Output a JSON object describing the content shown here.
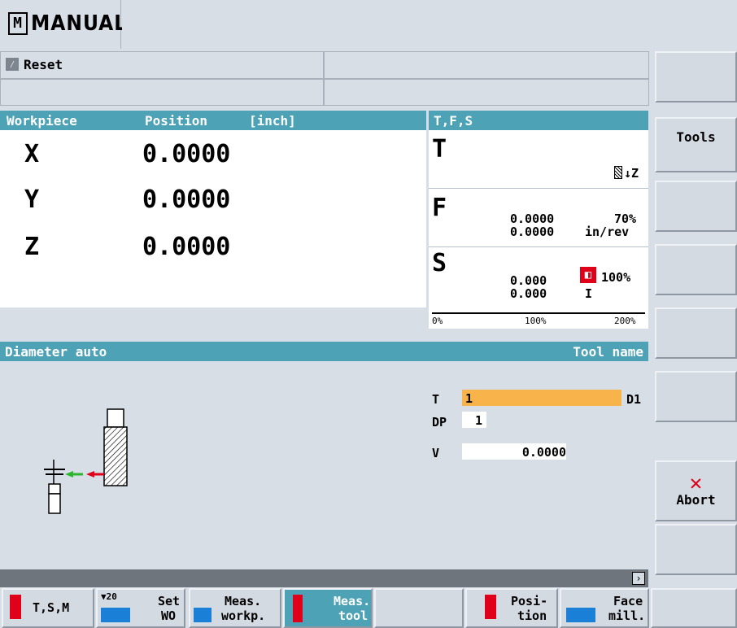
{
  "header": {
    "mode_label": "MANUAL",
    "reset_label": "Reset"
  },
  "workpiece": {
    "col_workpiece": "Workpiece",
    "col_position": "Position",
    "col_unit": "[inch]",
    "axes": [
      {
        "name": "X",
        "value": "0.0000"
      },
      {
        "name": "Y",
        "value": "0.0000"
      },
      {
        "name": "Z",
        "value": "0.0000"
      }
    ]
  },
  "tfs": {
    "title": "T,F,S",
    "t_label": "T",
    "t_dir": "Z",
    "f_label": "F",
    "f_val1": "0.0000",
    "f_val2": "0.0000",
    "f_percent": "70%",
    "f_unit": "in/rev",
    "s_label": "S",
    "s_val1": "0.000",
    "s_val2": "0.000",
    "s_percent": "100%",
    "s_gear": "I",
    "scale": [
      "0%",
      "100%",
      "200%"
    ]
  },
  "measure": {
    "title": "Diameter auto",
    "tool_name_label": "Tool name",
    "t_label": "T",
    "t_value": "1",
    "d_value": "D1",
    "dp_label": "DP",
    "dp_value": "1",
    "v_label": "V",
    "v_value": "0.0000"
  },
  "softkeys_vertical": [
    "",
    "Tools",
    "",
    "",
    "",
    "",
    "Abort",
    ""
  ],
  "softkeys_horizontal": [
    {
      "label": "T,S,M",
      "icon": "tsm-icon"
    },
    {
      "label1": "Set",
      "label2": "WO",
      "icon": "set-wo-icon"
    },
    {
      "label1": "Meas.",
      "label2": "workp.",
      "icon": "meas-workpiece-icon"
    },
    {
      "label1": "Meas.",
      "label2": "tool",
      "icon": "meas-tool-icon"
    },
    {
      "label1": "",
      "label2": ""
    },
    {
      "label1": "Posi-",
      "label2": "tion",
      "icon": "position-icon"
    },
    {
      "label1": "Face",
      "label2": "mill.",
      "icon": "face-mill-icon"
    },
    {
      "label1": "",
      "label2": ""
    }
  ],
  "colors": {
    "header": "#4da2b6",
    "highlight": "#f8b34a",
    "abort": "#e0001a",
    "red_icon": "#e0001a"
  }
}
